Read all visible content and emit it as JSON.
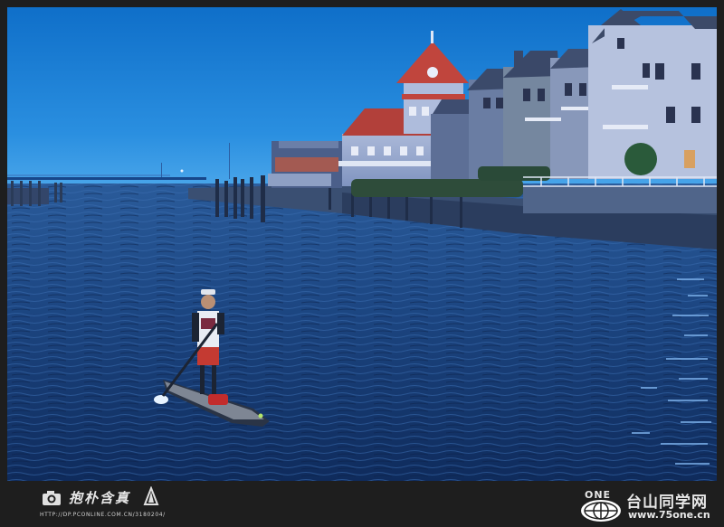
{
  "footer": {
    "signature": "抱朴含真",
    "photographer_url": "HTTP://DP.PCONLINE.COM.CN/3180204/",
    "site_name": "台山同学网",
    "site_url": "www.75one.cn",
    "logo_text": "ONE"
  },
  "colors": {
    "sky": "#1a86d8",
    "water": "#1a3f78",
    "border": "#1e1e1e",
    "roof": "#b2403a"
  },
  "icons": [
    "camera-icon",
    "sail-logo-icon",
    "globe-logo-icon"
  ]
}
